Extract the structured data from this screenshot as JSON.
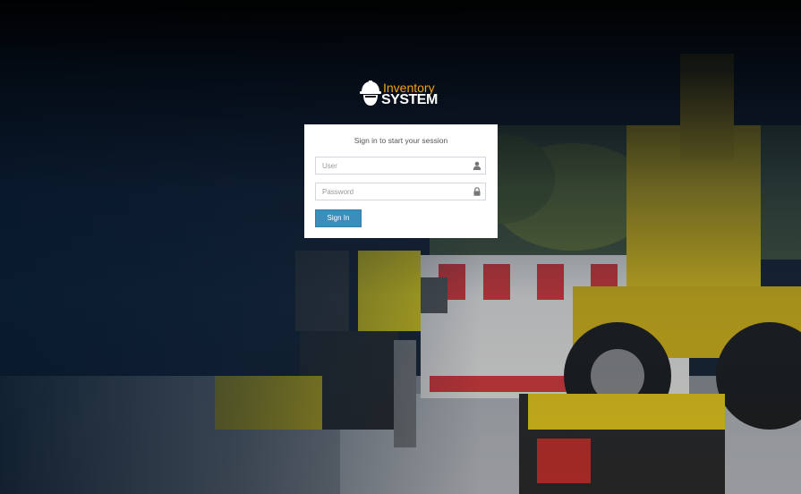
{
  "logo": {
    "line1": "Inventory",
    "line2": "SYSTEM",
    "icon": "hard-hat-worker-icon"
  },
  "login": {
    "message": "Sign in to start your session",
    "user_placeholder": "User",
    "password_placeholder": "Password",
    "user_icon": "user-icon",
    "password_icon": "lock-icon",
    "signin_label": "Sign In"
  },
  "colors": {
    "accent": "#f0a21a",
    "button": "#3c8dbc",
    "background_dark": "#0b1320"
  }
}
